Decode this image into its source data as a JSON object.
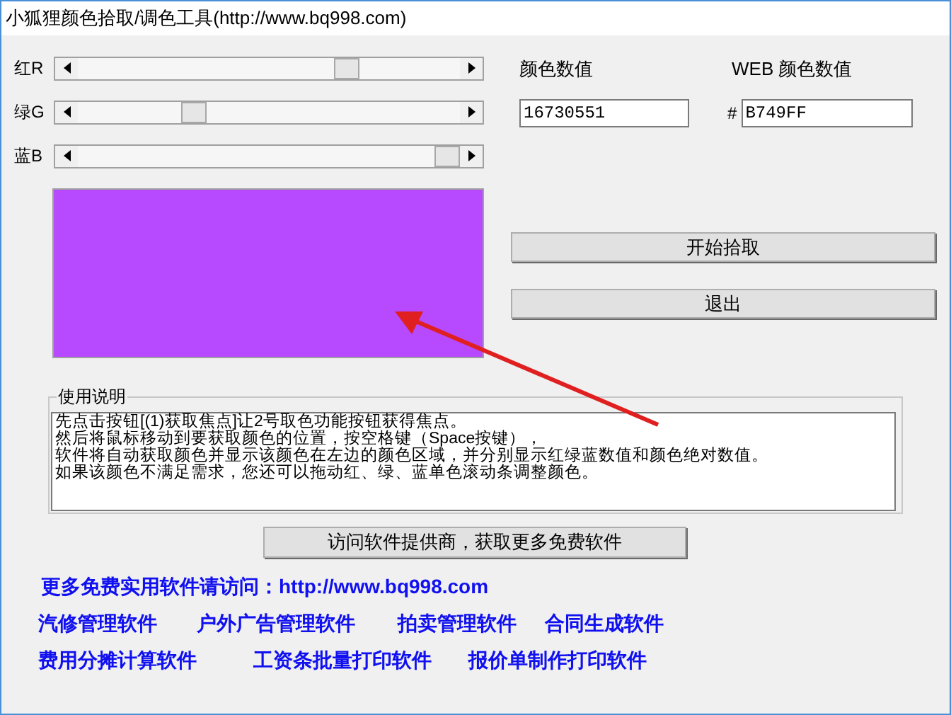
{
  "window": {
    "title": "小狐狸颜色拾取/调色工具(http://www.bq998.com)"
  },
  "sliders": [
    {
      "label": "红R"
    },
    {
      "label": "绿G"
    },
    {
      "label": "蓝B"
    }
  ],
  "color_value": {
    "label": "颜色数值",
    "value": "16730551"
  },
  "web_color_value": {
    "label": "WEB 颜色数值",
    "prefix": "#",
    "value": "B749FF"
  },
  "swatch": {
    "color": "#b749ff"
  },
  "buttons": [
    "开始拾取",
    "退出"
  ],
  "instructions": {
    "title": "使用说明",
    "lines": [
      "先点击按钮[(1)获取焦点]让2号取色功能按钮获得焦点。",
      "然后将鼠标移动到要获取颜色的位置，按空格键（Space按键），",
      "软件将自动获取颜色并显示该颜色在左边的颜色区域，并分别显示红绿蓝数值和颜色绝对数值。",
      "如果该颜色不满足需求，您还可以拖动红、绿、蓝单色滚动条调整颜色。"
    ]
  },
  "visit_button": "访问软件提供商，获取更多免费软件",
  "promo": {
    "heading": "更多免费实用软件请访问：http://www.bq998.com",
    "rows": [
      [
        "汽修管理软件",
        "户外广告管理软件",
        "拍卖管理软件",
        "合同生成软件"
      ],
      [
        "费用分摊计算软件",
        "工资条批量打印软件",
        "报价单制作打印软件"
      ]
    ]
  }
}
